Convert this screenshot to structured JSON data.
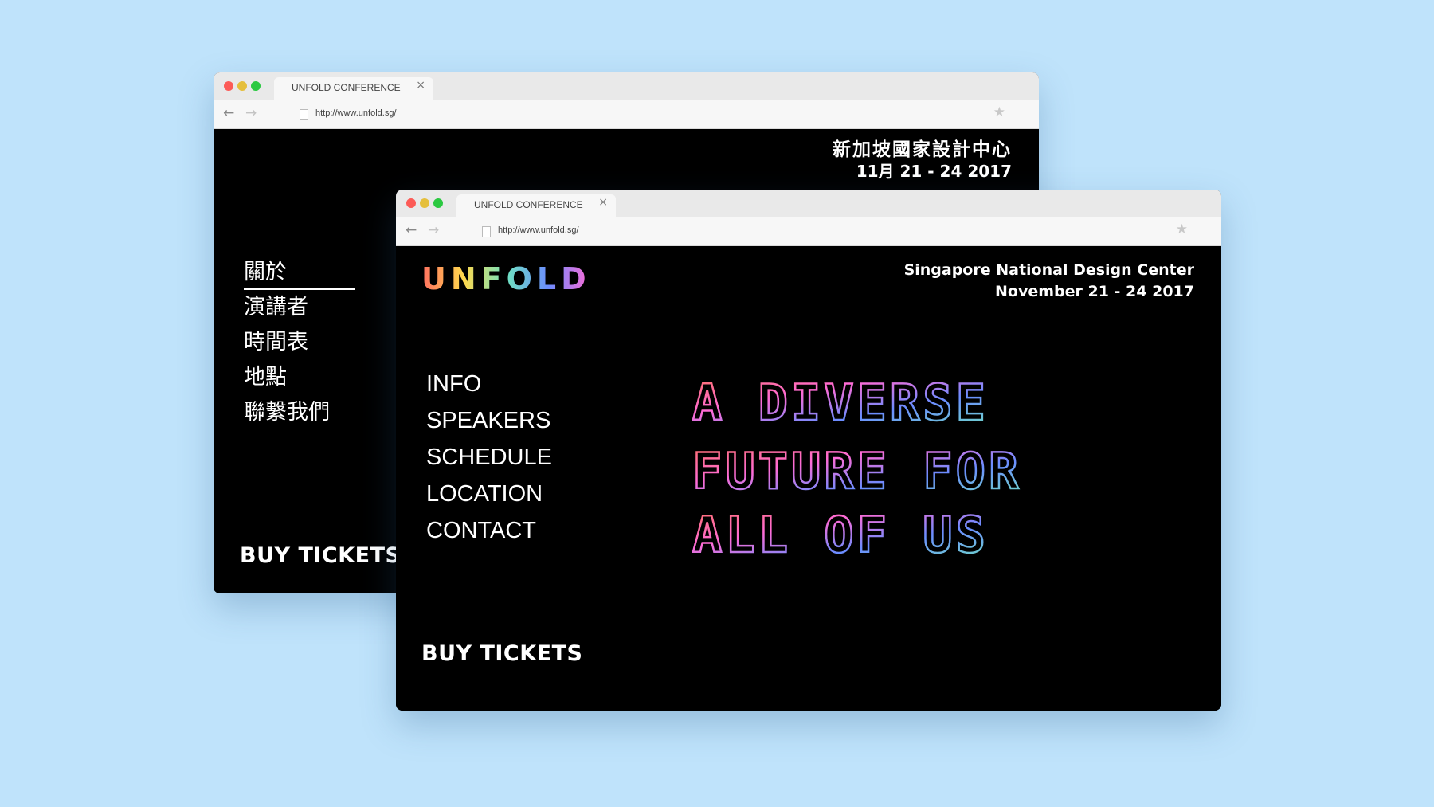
{
  "colors": {
    "background": "#bfe3fb",
    "page_bg": "#000000",
    "text": "#ffffff",
    "gradient": [
      "#ff6f61",
      "#ffd84d",
      "#6fe3c1",
      "#6b8cff",
      "#ff6bd6"
    ]
  },
  "windows": {
    "back": {
      "tab_title": "UNFOLD CONFERENCE",
      "url": "http://www.unfold.sg/",
      "venue_line1": "新加坡國家設計中心",
      "venue_line2": "11月 21 - 24 2017",
      "nav": [
        "關於",
        "演講者",
        "時間表",
        "地點",
        "聯繫我們"
      ],
      "active_nav": "關於",
      "buy": "BUY TICKETS"
    },
    "front": {
      "tab_title": "UNFOLD CONFERENCE",
      "url": "http://www.unfold.sg/",
      "logo": "UNFOLD",
      "venue_line1": "Singapore National Design Center",
      "venue_line2": "November 21 - 24 2017",
      "nav": [
        "INFO",
        "SPEAKERS",
        "SCHEDULE",
        "LOCATION",
        "CONTACT"
      ],
      "headline": [
        "A DIVERSE",
        "FUTURE FOR",
        "ALL OF US"
      ],
      "buy": "BUY TICKETS"
    }
  },
  "icons": {
    "close": "close-icon",
    "back": "back-arrow-icon",
    "forward": "forward-arrow-icon",
    "page": "page-icon",
    "bookmark": "bookmark-star-icon"
  }
}
